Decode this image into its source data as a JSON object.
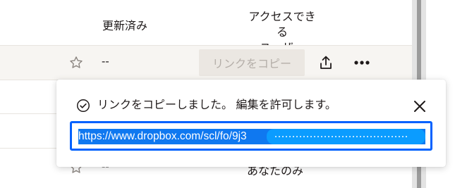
{
  "header": {
    "col_updated": "更新済み",
    "col_access": "アクセスできる\nユーザー"
  },
  "rows": [
    {
      "updated": "--",
      "copy_link_label": "リンクをコピー"
    },
    {
      "updated": "--",
      "access_text": "あなたのみ"
    }
  ],
  "popover": {
    "message": "リンクをコピーしました。 編集を許可します。",
    "link_visible": "https://www.dropbox.com/scl/fo/9j3"
  },
  "colors": {
    "accent": "#0061fe",
    "selection": "#0f78f0",
    "disabled_button_bg": "#ebe7e2",
    "disabled_button_text": "#b4aea8"
  },
  "icons": [
    "star-icon",
    "share-icon",
    "more-icon",
    "check-circle-icon",
    "close-icon"
  ]
}
